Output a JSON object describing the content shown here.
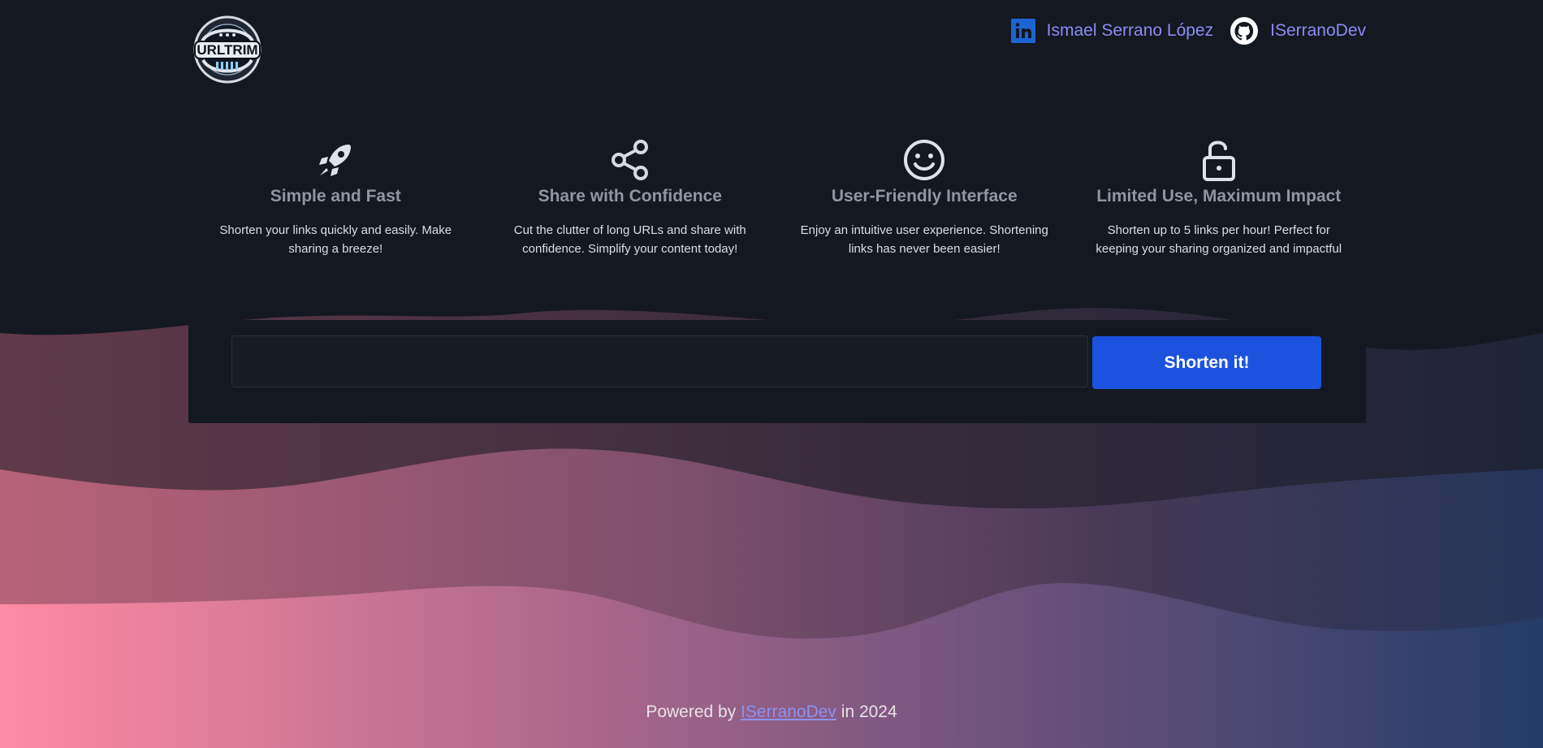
{
  "header": {
    "logo_text": "URLTRIM",
    "links": [
      {
        "label": "Ismael Serrano López",
        "icon": "linkedin-icon"
      },
      {
        "label": "ISerranoDev",
        "icon": "github-icon"
      }
    ]
  },
  "features": [
    {
      "icon": "rocket-icon",
      "title": "Simple and Fast",
      "description": "Shorten your links quickly and easily. Make sharing a breeze!"
    },
    {
      "icon": "share-icon",
      "title": "Share with Confidence",
      "description": "Cut the clutter of long URLs and share with confidence. Simplify your content today!"
    },
    {
      "icon": "smile-icon",
      "title": "User-Friendly Interface",
      "description": "Enjoy an intuitive user experience. Shortening links has never been easier!"
    },
    {
      "icon": "unlock-icon",
      "title": "Limited Use, Maximum Impact",
      "description": "Shorten up to 5 links per hour! Perfect for keeping your sharing organized and impactful"
    }
  ],
  "form": {
    "input_value": "",
    "input_placeholder": "",
    "button_label": "Shorten it!"
  },
  "footer": {
    "prefix": "Powered by ",
    "link": "ISerranoDev",
    "suffix": " in 2024"
  },
  "colors": {
    "background": "#141820",
    "accent_link": "#8b8cf5",
    "button": "#1b53df",
    "feature_title": "#8f96a3",
    "wave_pink": "#ff8aa4",
    "wave_blue": "#243c68"
  }
}
